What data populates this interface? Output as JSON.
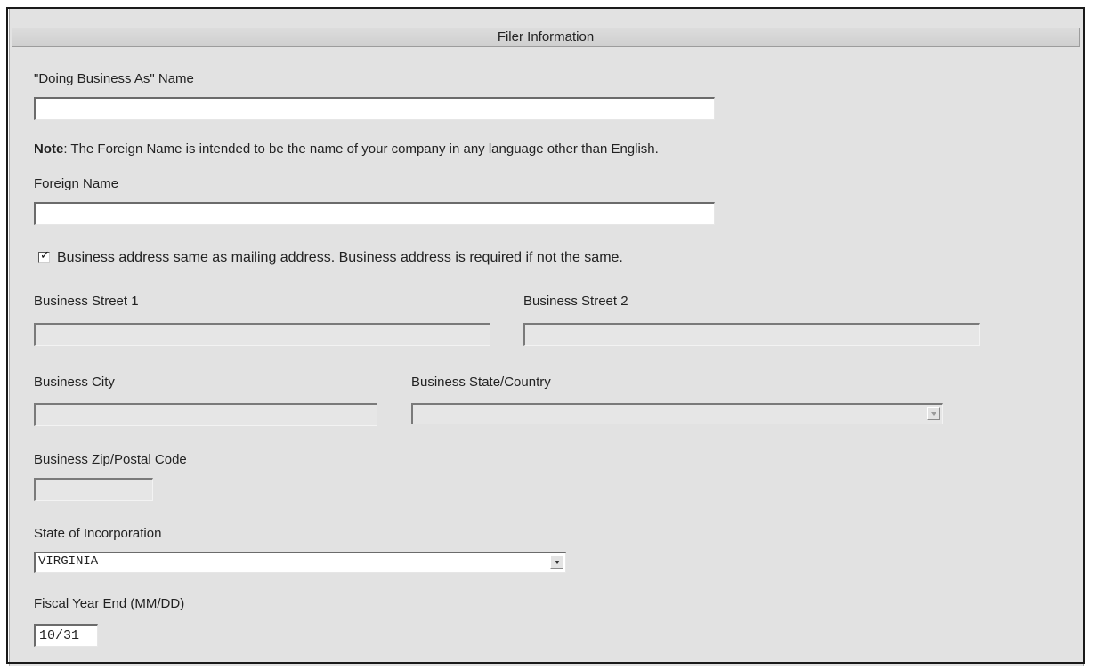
{
  "header": {
    "title": "Filer Information"
  },
  "dba": {
    "label": "\"Doing Business As\" Name",
    "value": ""
  },
  "note": {
    "bold": "Note",
    "text": ": The Foreign Name is intended to be the name of your company in any language other than English."
  },
  "foreign_name": {
    "label": "Foreign Name",
    "value": ""
  },
  "same_address": {
    "checked": true,
    "label": "Business address same as mailing address. Business address is required if not the same."
  },
  "business_street_1": {
    "label": "Business Street 1",
    "value": "",
    "disabled": true
  },
  "business_street_2": {
    "label": "Business Street 2",
    "value": "",
    "disabled": true
  },
  "business_city": {
    "label": "Business City",
    "value": "",
    "disabled": true
  },
  "business_state_country": {
    "label": "Business State/Country",
    "selected": "",
    "disabled": true
  },
  "business_zip": {
    "label": "Business Zip/Postal Code",
    "value": "",
    "disabled": true
  },
  "state_of_incorporation": {
    "label": "State of Incorporation",
    "selected": "VIRGINIA"
  },
  "fiscal_year_end": {
    "label": "Fiscal Year End (MM/DD)",
    "value": "10/31"
  },
  "icons": {
    "checkbox_checked": "check-icon",
    "dropdown_arrow": "chevron-down-icon"
  }
}
